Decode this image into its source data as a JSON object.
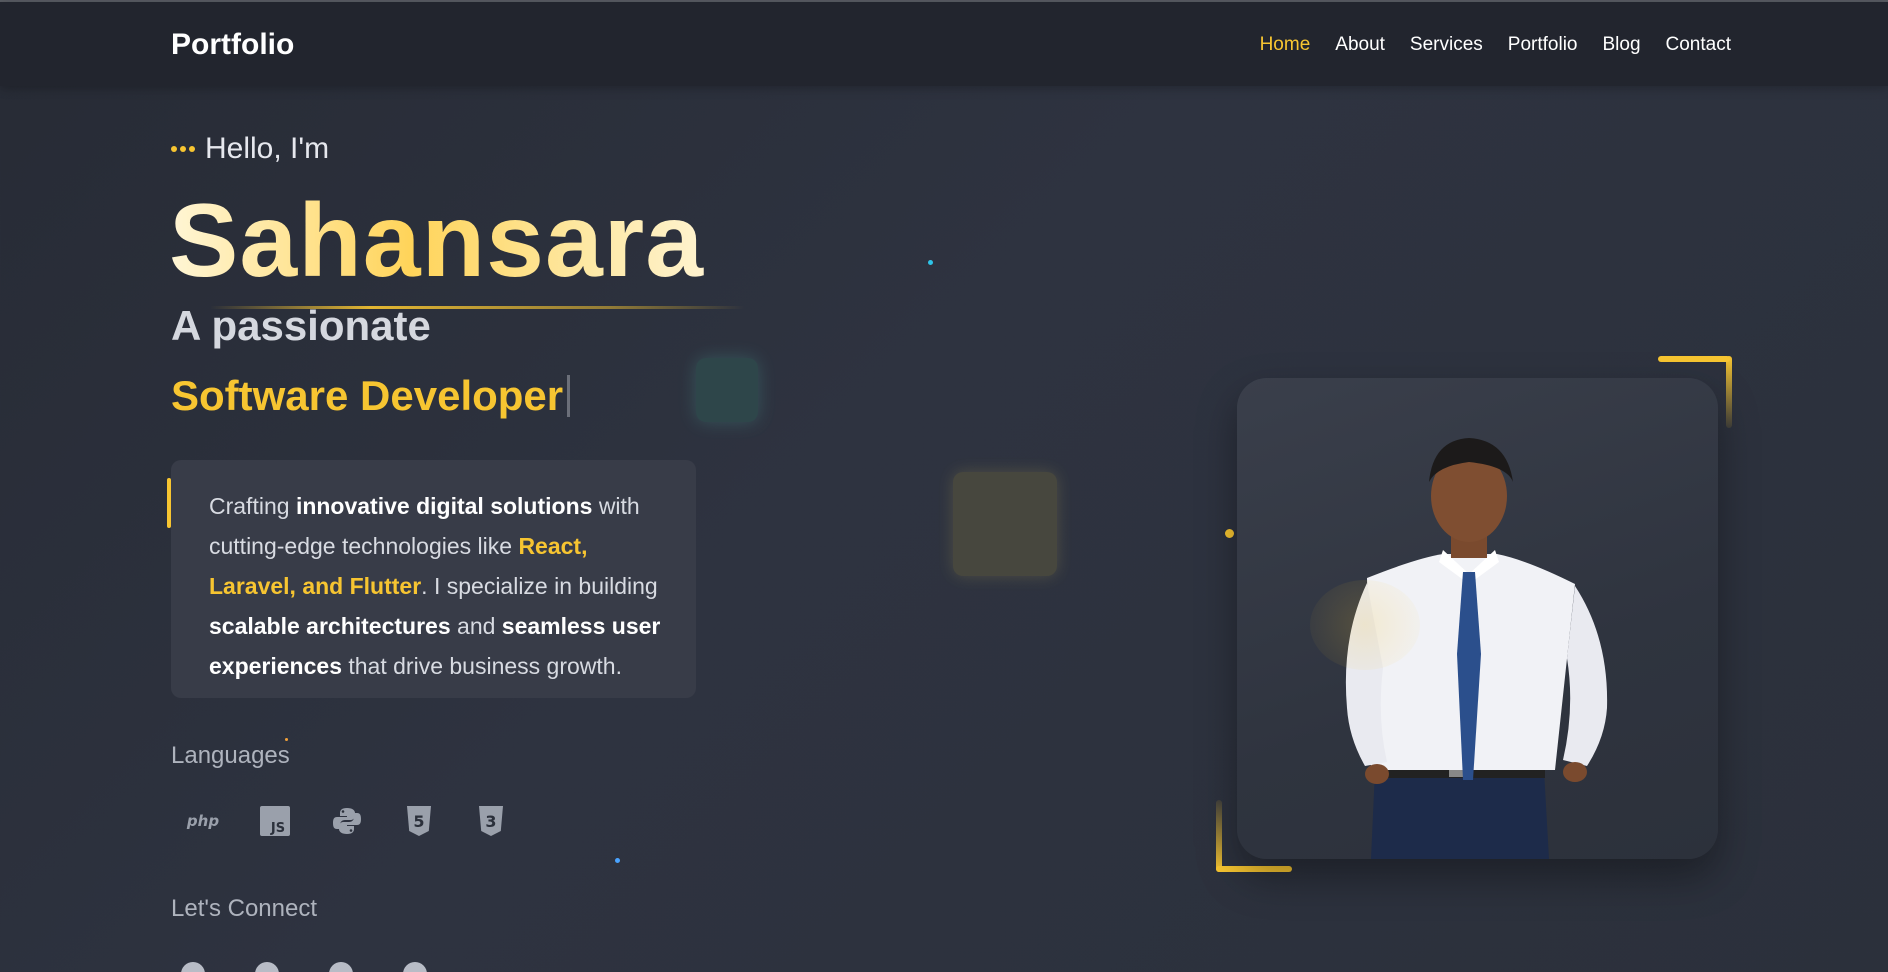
{
  "header": {
    "brand": "Portfolio",
    "nav": [
      {
        "label": "Home",
        "active": true
      },
      {
        "label": "About",
        "active": false
      },
      {
        "label": "Services",
        "active": false
      },
      {
        "label": "Portfolio",
        "active": false
      },
      {
        "label": "Blog",
        "active": false
      },
      {
        "label": "Contact",
        "active": false
      }
    ]
  },
  "hero": {
    "greeting": "Hello, I'm",
    "name": "Sahansara",
    "tagline": "A passionate",
    "role": "Software Developer",
    "intro": {
      "p1": "Crafting",
      "b1": "innovative digital solutions",
      "p2": "with cutting-edge technologies like",
      "highlight": "React, Laravel, and Flutter",
      "p3": ". I specialize in building",
      "b2": "scalable architectures",
      "p4": "and",
      "b3": "seamless user experiences",
      "p5": "that drive business growth."
    },
    "languages_label": "Languages",
    "languages": [
      {
        "icon": "php-icon",
        "text": "php"
      },
      {
        "icon": "javascript-icon",
        "text": "JS"
      },
      {
        "icon": "python-icon",
        "text": ""
      },
      {
        "icon": "html5-icon",
        "text": "5"
      },
      {
        "icon": "css3-icon",
        "text": "3"
      }
    ],
    "connect_label": "Let's Connect",
    "connect": [
      "linkedin-icon",
      "github-icon",
      "x-icon",
      "heart-icon"
    ]
  },
  "colors": {
    "accent": "#f7c531",
    "background": "#2b303b",
    "navbar": "#22252e",
    "card": "#383c48"
  }
}
